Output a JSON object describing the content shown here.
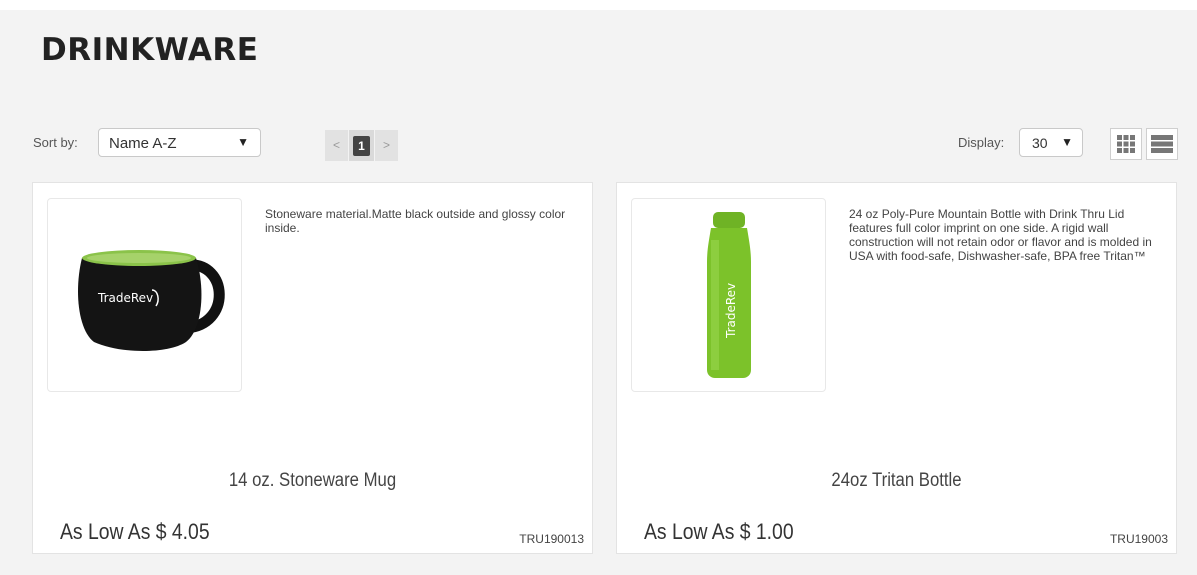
{
  "page": {
    "title": "DRINKWARE"
  },
  "toolbar": {
    "sort_label": "Sort by:",
    "sort_value": "Name A-Z",
    "pagination": {
      "prev": "<",
      "current": "1",
      "next": ">"
    },
    "display_label": "Display:",
    "display_value": "30"
  },
  "products": [
    {
      "description": "Stoneware material.Matte black outside and glossy color inside.",
      "name": "14 oz. Stoneware Mug",
      "price": "As Low As $ 4.05",
      "sku": "TRU190013",
      "image_text": "TradeRev",
      "image_color": "#8bc34a"
    },
    {
      "description": "24 oz Poly-Pure Mountain Bottle with Drink Thru Lid features full color imprint on one side. A rigid wall construction will not retain odor or flavor and is molded in USA with food-safe, Dishwasher-safe, BPA free Tritan™",
      "name": "24oz Tritan Bottle",
      "price": "As Low As $ 1.00",
      "sku": "TRU19003",
      "image_text": "TradeRev",
      "image_color": "#7cc22a"
    }
  ],
  "colors": {
    "page_bg": "#f3f3f3",
    "card_bg": "#ffffff",
    "pager_active": "#444444"
  }
}
